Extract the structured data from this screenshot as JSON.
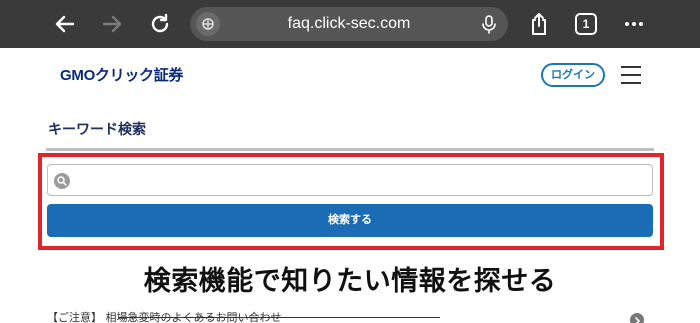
{
  "browser": {
    "url": "faq.click-sec.com",
    "tab_count": "1",
    "icons": [
      "back-arrow-icon",
      "forward-arrow-icon",
      "reload-icon",
      "site-settings-icon",
      "microphone-icon",
      "share-icon",
      "tabs-icon",
      "more-icon"
    ]
  },
  "header": {
    "logo_text": "GMOクリック証券",
    "login_label": "ログイン",
    "menu_icon": "hamburger-menu-icon"
  },
  "keyword_search": {
    "title": "キーワード検索",
    "input_value": "",
    "input_placeholder": "",
    "button_label": "検索する"
  },
  "caption": "検索機能で知りたい情報を探せる",
  "notice": {
    "text": "【ご注意】 相場急変時のよくあるお問い合わせ"
  },
  "colors": {
    "browser_bar": "#3a3a3a",
    "brand_blue": "#1a6db5",
    "highlight_red": "#e0262b",
    "logo_navy": "#0a2a7a"
  }
}
